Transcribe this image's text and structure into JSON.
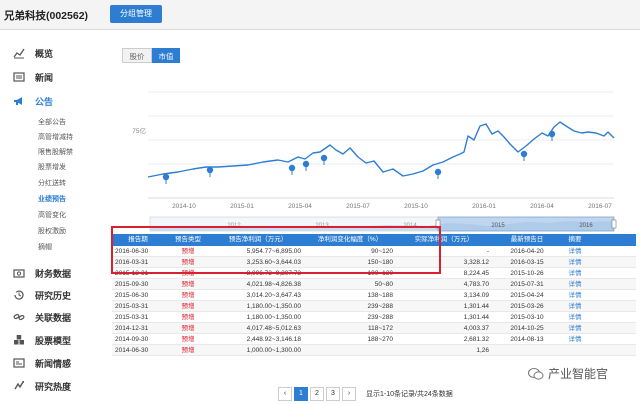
{
  "header": {
    "company": "兄弟科技(002562)",
    "group_btn": "分组管理"
  },
  "sidebar": {
    "items": [
      {
        "label": "概览",
        "icon": "chart-line-icon"
      },
      {
        "label": "新闻",
        "icon": "newspaper-icon"
      },
      {
        "label": "公告",
        "icon": "megaphone-icon",
        "active": true
      },
      {
        "label": "财务数据",
        "icon": "money-icon"
      },
      {
        "label": "研究历史",
        "icon": "history-icon"
      },
      {
        "label": "关联数据",
        "icon": "link-icon"
      },
      {
        "label": "股票模型",
        "icon": "cubes-icon"
      },
      {
        "label": "新闻情感",
        "icon": "sentiment-icon"
      },
      {
        "label": "研究热度",
        "icon": "heat-icon"
      }
    ],
    "sub_items": [
      "全部公告",
      "高管增减持",
      "限售股解禁",
      "股票增发",
      "分红送转",
      "业绩预告",
      "高管变化",
      "股权激励",
      "摘帽"
    ],
    "active_sub": 5
  },
  "chart": {
    "toggle_price": "股价",
    "toggle_mcap": "市值",
    "y_label": "75亿",
    "x_ticks": [
      "2014-10",
      "2015-01",
      "2015-04",
      "2015-07",
      "2015-10",
      "2016-01",
      "2016-04",
      "2016-07"
    ],
    "nav_ticks": [
      "2012",
      "2013",
      "2014",
      "2015",
      "2016"
    ]
  },
  "table": {
    "headers": [
      "报告期",
      "预告类型",
      "预告净利润（万元）",
      "净利润变化幅度（%）",
      "实际净利润（万元）",
      "最新预告日",
      "摘要"
    ],
    "rows": [
      [
        "2016-06-30",
        "预增",
        "5,954.77~6,895.00",
        "90~120",
        "-",
        "2016-04-20",
        "详情"
      ],
      [
        "2016-03-31",
        "预增",
        "3,253.60~3,644.03",
        "150~180",
        "3,328.12",
        "2016-03-15",
        "详情"
      ],
      [
        "2015-12-31",
        "预增",
        "8,006.72~9,207.73",
        "100~130",
        "8,224.45",
        "2015-10-26",
        "详情"
      ],
      [
        "2015-09-30",
        "预增",
        "4,021.98~4,826.38",
        "50~80",
        "4,783.70",
        "2015-07-31",
        "详情"
      ],
      [
        "2015-06-30",
        "预增",
        "3,014.20~3,647.43",
        "138~188",
        "3,134.09",
        "2015-04-24",
        "详情"
      ],
      [
        "2015-03-31",
        "预增",
        "1,180.00~1,350.00",
        "239~288",
        "1,301.44",
        "2015-03-26",
        "详情"
      ],
      [
        "2015-03-31",
        "预增",
        "1,180.00~1,350.00",
        "239~288",
        "1,301.44",
        "2015-03-10",
        "详情"
      ],
      [
        "2014-12-31",
        "预增",
        "4,017.48~5,012.63",
        "118~172",
        "4,003.37",
        "2014-10-25",
        "详情"
      ],
      [
        "2014-09-30",
        "预增",
        "2,448.92~3,146.18",
        "188~270",
        "2,681.32",
        "2014-08-13",
        "详情"
      ],
      [
        "2014-06-30",
        "预增",
        "1,000.00~1,300.00",
        "",
        "1,26",
        "",
        ""
      ]
    ]
  },
  "pager": {
    "pages": [
      "1",
      "2",
      "3"
    ],
    "prev": "‹",
    "next": "›",
    "info": "显示1-10条记录/共24条数据"
  },
  "watermark": {
    "text": "产业智能官"
  },
  "colors": {
    "accent": "#2d7ed3",
    "highlight": "#d9202e",
    "chart_fill": "#c9dcf0"
  }
}
